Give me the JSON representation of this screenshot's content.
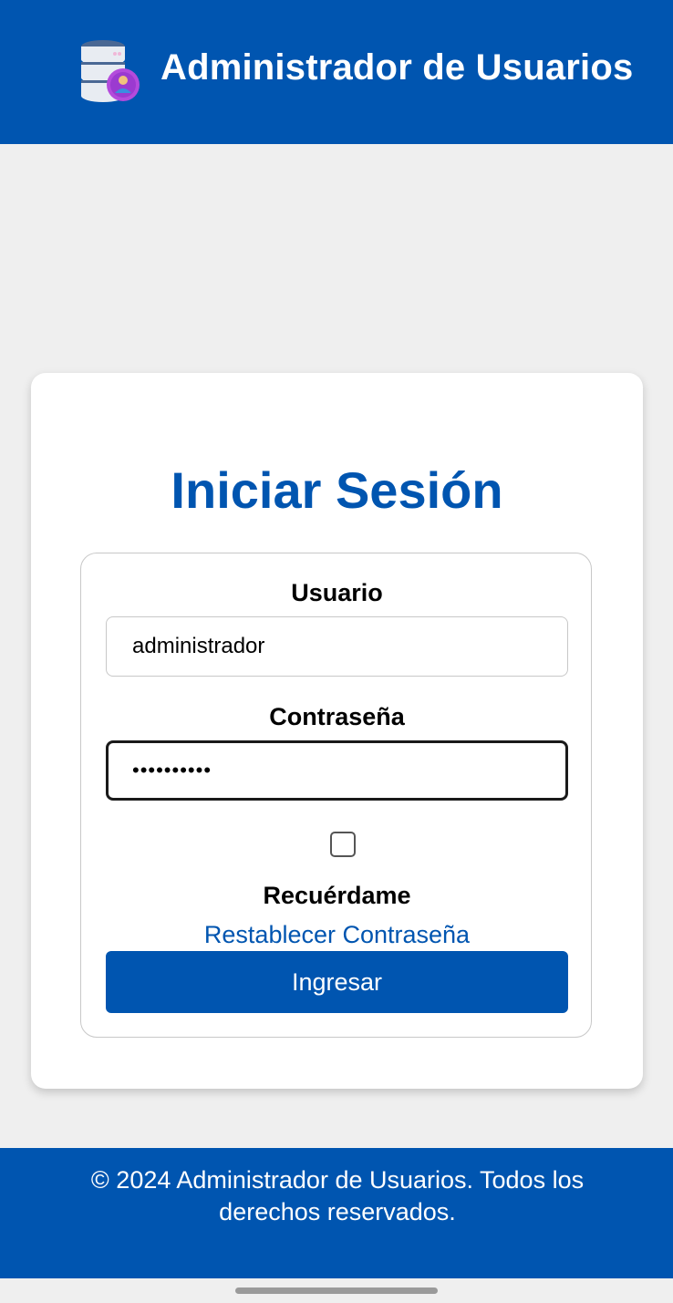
{
  "header": {
    "title": "Administrador de Usuarios",
    "logo_icon": "database-user-icon"
  },
  "login": {
    "title": "Iniciar Sesión",
    "username_label": "Usuario",
    "username_value": "administrador",
    "password_label": "Contraseña",
    "password_value": "••••••••••",
    "remember_label": "Recuérdame",
    "remember_checked": false,
    "reset_link": "Restablecer Contraseña",
    "submit_label": "Ingresar"
  },
  "footer": {
    "text": "© 2024 Administrador de Usuarios. Todos los derechos reservados."
  },
  "colors": {
    "brand": "#0055b0",
    "background": "#efefef",
    "card": "#ffffff"
  }
}
